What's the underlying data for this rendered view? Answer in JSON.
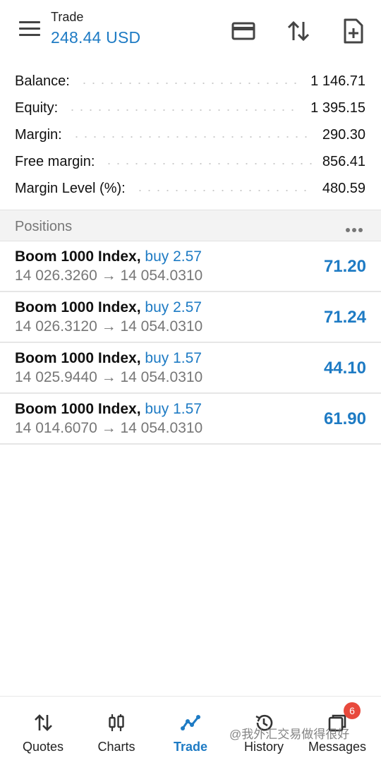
{
  "header": {
    "title": "Trade",
    "amount": "248.44 USD",
    "icons": [
      "menu-icon",
      "card-icon",
      "sort-arrows-icon",
      "new-order-icon"
    ]
  },
  "summary": [
    {
      "label": "Balance:",
      "value": "1 146.71"
    },
    {
      "label": "Equity:",
      "value": "1 395.15"
    },
    {
      "label": "Margin:",
      "value": "290.30"
    },
    {
      "label": "Free margin:",
      "value": "856.41"
    },
    {
      "label": "Margin Level (%):",
      "value": "480.59"
    }
  ],
  "positions_header": {
    "title": "Positions"
  },
  "positions": [
    {
      "symbol": "Boom 1000 Index,",
      "side": "buy 2.57",
      "prices": "14 026.3260 → 14 054.0310",
      "profit": "71.20"
    },
    {
      "symbol": "Boom 1000 Index,",
      "side": "buy 2.57",
      "prices": "14 026.3120 → 14 054.0310",
      "profit": "71.24"
    },
    {
      "symbol": "Boom 1000 Index,",
      "side": "buy 1.57",
      "prices": "14 025.9440 → 14 054.0310",
      "profit": "44.10"
    },
    {
      "symbol": "Boom 1000 Index,",
      "side": "buy 1.57",
      "prices": "14 014.6070 → 14 054.0310",
      "profit": "61.90"
    }
  ],
  "nav": [
    {
      "label": "Quotes",
      "icon": "quotes-icon"
    },
    {
      "label": "Charts",
      "icon": "charts-icon"
    },
    {
      "label": "Trade",
      "icon": "trade-icon",
      "active": true
    },
    {
      "label": "History",
      "icon": "history-icon"
    },
    {
      "label": "Messages",
      "icon": "messages-icon",
      "badge": "6"
    }
  ],
  "watermark": "@我外汇交易做得很好",
  "colors": {
    "accent": "#1e7bc4",
    "badge": "#e8493c",
    "muted": "#777777"
  }
}
